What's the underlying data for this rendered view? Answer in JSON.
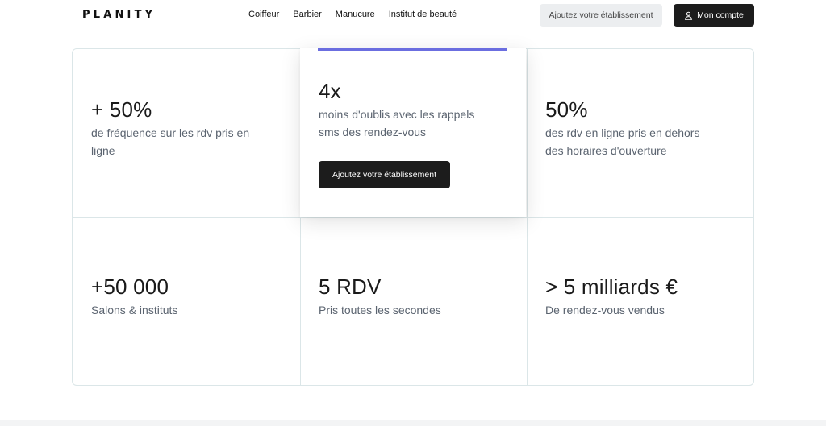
{
  "header": {
    "logo": "PLANITY",
    "nav": [
      "Coiffeur",
      "Barbier",
      "Manucure",
      "Institut de beauté"
    ],
    "add_business_label": "Ajoutez votre établissement",
    "account_label": "Mon compte",
    "account_icon": "user-icon"
  },
  "stats": [
    {
      "value": "+ 50%",
      "desc_line1": "de fréquence sur les rdv pris en",
      "desc_line2": "ligne"
    },
    {
      "value": "4x",
      "desc_line1": "moins d'oublis avec les rappels",
      "desc_line2": "sms des rendez-vous",
      "button": "Ajoutez votre établissement"
    },
    {
      "value": "50%",
      "desc_line1": "des rdv en ligne pris en dehors",
      "desc_line2": "des horaires d'ouverture"
    },
    {
      "value": "+50 000",
      "desc_line1": "Salons & instituts"
    },
    {
      "value": "5 RDV",
      "desc_line1": "Pris toutes les secondes"
    },
    {
      "value": "> 5 milliards €",
      "desc_line1": "De rendez-vous vendus"
    }
  ],
  "colors": {
    "accent": "#6b6ee0",
    "dark_button": "#1c1c1c",
    "light_button": "#eceef0",
    "border": "#dbe6e8"
  }
}
